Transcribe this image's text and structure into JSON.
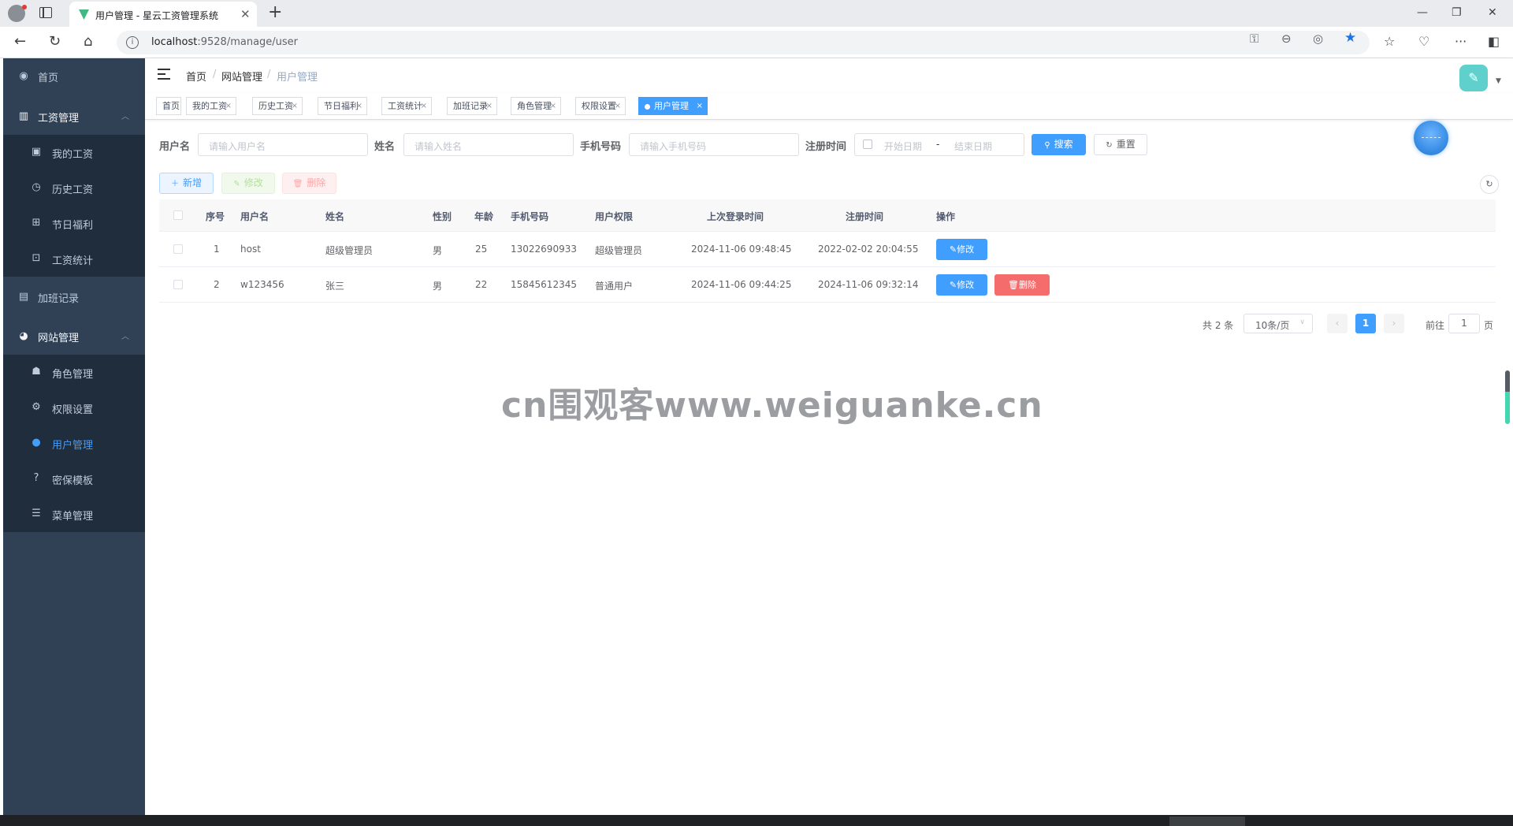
{
  "browser": {
    "tab_title": "用户管理 - 星云工资管理系统",
    "url_host": "localhost",
    "url_path": ":9528/manage/user"
  },
  "sidebar": {
    "home": "首页",
    "salary": {
      "label": "工资管理",
      "children": [
        "我的工资",
        "历史工资",
        "节日福利",
        "工资统计"
      ]
    },
    "overtime": "加班记录",
    "website": {
      "label": "网站管理",
      "children": [
        "角色管理",
        "权限设置",
        "用户管理",
        "密保模板",
        "菜单管理"
      ]
    }
  },
  "breadcrumb": [
    "首页",
    "网站管理",
    "用户管理"
  ],
  "tags": [
    "首页",
    "我的工资",
    "历史工资",
    "节日福利",
    "工资统计",
    "加班记录",
    "角色管理",
    "权限设置",
    "用户管理"
  ],
  "search": {
    "username_label": "用户名",
    "username_placeholder": "请输入用户名",
    "name_label": "姓名",
    "name_placeholder": "请输入姓名",
    "phone_label": "手机号码",
    "phone_placeholder": "请输入手机号码",
    "regtime_label": "注册时间",
    "start_placeholder": "开始日期",
    "range_sep": "-",
    "end_placeholder": "结束日期",
    "search_btn": "搜索",
    "reset_btn": "重置"
  },
  "toolbar": {
    "add": "新增",
    "edit": "修改",
    "delete": "删除"
  },
  "table": {
    "headers": [
      "序号",
      "用户名",
      "姓名",
      "性别",
      "年龄",
      "手机号码",
      "用户权限",
      "上次登录时间",
      "注册时间",
      "操作"
    ],
    "rows": [
      {
        "idx": "1",
        "username": "host",
        "name": "超级管理员",
        "gender": "男",
        "age": "25",
        "phone": "13022690933",
        "role": "超级管理员",
        "last_login": "2024-11-06 09:48:45",
        "reg_time": "2022-02-02 20:04:55"
      },
      {
        "idx": "2",
        "username": "w123456",
        "name": "张三",
        "gender": "男",
        "age": "22",
        "phone": "15845612345",
        "role": "普通用户",
        "last_login": "2024-11-06 09:44:25",
        "reg_time": "2024-11-06 09:32:14"
      }
    ],
    "edit_btn": "修改",
    "delete_btn": "删除"
  },
  "pagination": {
    "total": "共 2 条",
    "page_size": "10条/页",
    "current": "1",
    "goto_prefix": "前往",
    "goto_value": "1",
    "goto_suffix": "页"
  },
  "watermark": "cn围观客www.weiguanke.cn",
  "colors": {
    "sidebar_bg": "#304156",
    "submenu_bg": "#1f2d3d",
    "primary": "#409eff",
    "danger": "#f56c6c"
  }
}
